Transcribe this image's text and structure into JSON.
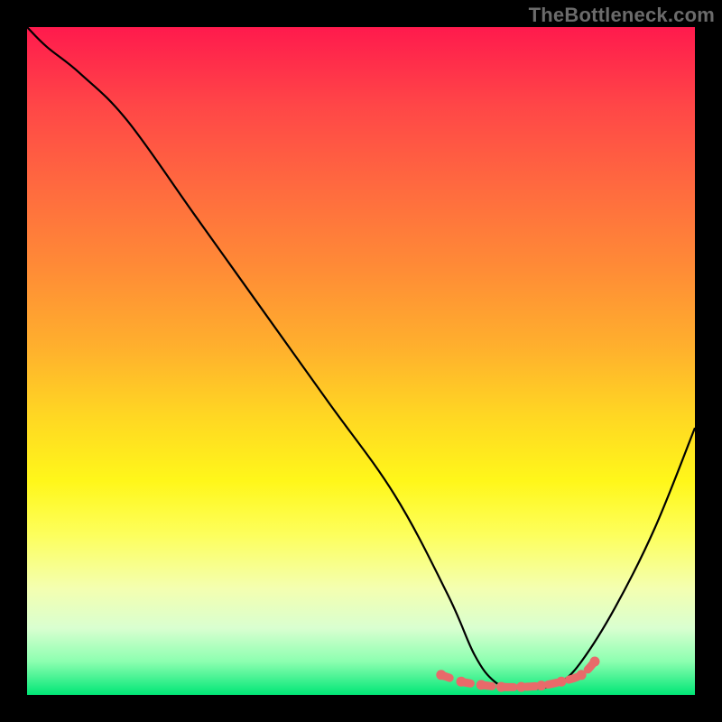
{
  "watermark": "TheBottleneck.com",
  "chart_data": {
    "type": "line",
    "title": "",
    "xlabel": "",
    "ylabel": "",
    "xlim": [
      0,
      100
    ],
    "ylim": [
      0,
      100
    ],
    "series": [
      {
        "name": "bottleneck-curve",
        "x": [
          0,
          3,
          8,
          15,
          25,
          35,
          45,
          55,
          63,
          67,
          70,
          73,
          77,
          80,
          83,
          88,
          94,
          100
        ],
        "y": [
          100,
          97,
          93,
          86,
          72,
          58,
          44,
          30,
          15,
          6,
          2,
          1,
          1,
          2,
          5,
          13,
          25,
          40
        ]
      },
      {
        "name": "minimum-marker-band",
        "x": [
          62,
          65,
          68,
          71,
          74,
          77,
          80,
          83,
          85
        ],
        "y": [
          3,
          2,
          1.5,
          1.2,
          1.2,
          1.4,
          2,
          3,
          5
        ]
      }
    ],
    "background_gradient": {
      "top": "#ff1a4d",
      "mid": "#ffe600",
      "bottom": "#00e676"
    },
    "curve_color": "#000000",
    "marker_color": "#e86a6a"
  }
}
